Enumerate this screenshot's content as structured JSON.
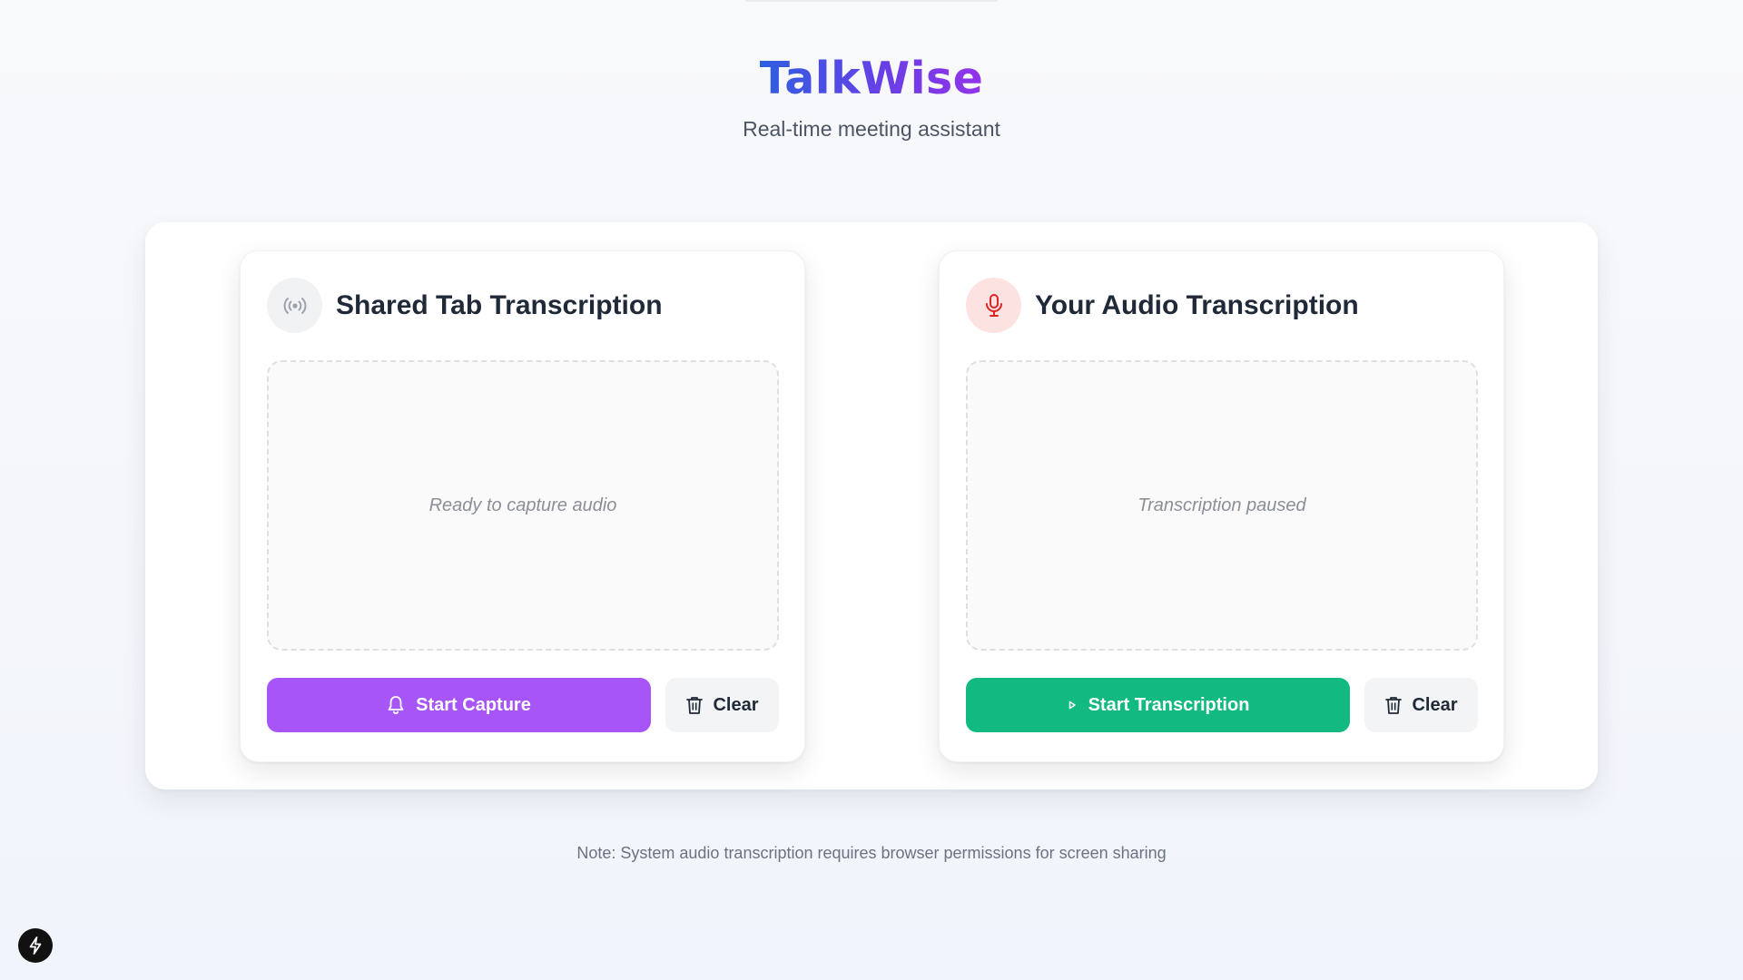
{
  "app": {
    "title": "TalkWise",
    "subtitle": "Real-time meeting assistant"
  },
  "panels": [
    {
      "title": "Shared Tab Transcription",
      "icon": "broadcast-icon",
      "placeholder": "Ready to capture audio",
      "primary_button": {
        "label": "Start Capture",
        "icon": "bell-icon",
        "color": "#a855f7"
      },
      "clear_button": {
        "label": "Clear",
        "icon": "trash-icon"
      }
    },
    {
      "title": "Your Audio Transcription",
      "icon": "microphone-icon",
      "placeholder": "Transcription paused",
      "primary_button": {
        "label": "Start Transcription",
        "icon": "play-icon",
        "color": "#12b981"
      },
      "clear_button": {
        "label": "Clear",
        "icon": "trash-icon"
      }
    }
  ],
  "note": "Note: System audio transcription requires browser permissions for screen sharing",
  "colors": {
    "brand_gradient_start": "#2f5fe0",
    "brand_gradient_end": "#9333ea",
    "mic_accent": "#dc2626"
  }
}
